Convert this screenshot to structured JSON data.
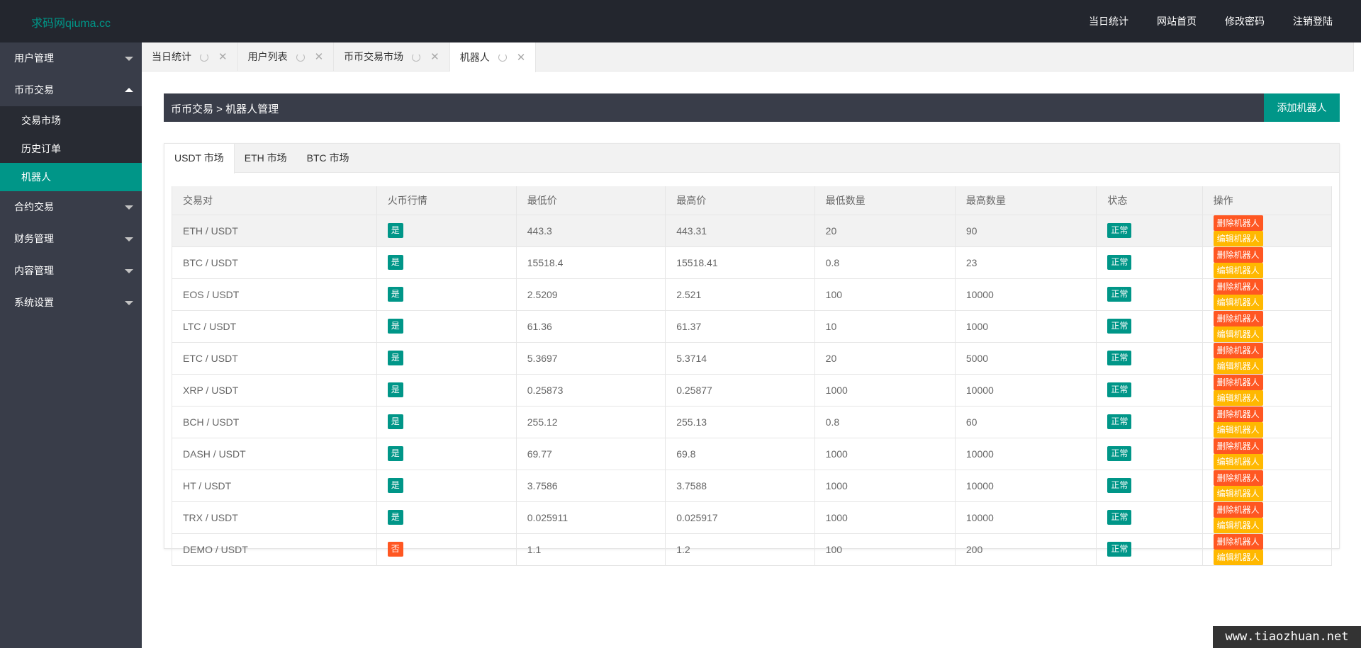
{
  "header": {
    "logo": "求码网qiuma.cc",
    "nav": [
      "当日统计",
      "网站首页",
      "修改密码",
      "注销登陆"
    ]
  },
  "sidebar": {
    "menus": [
      {
        "label": "用户管理",
        "expanded": false
      },
      {
        "label": "币币交易",
        "expanded": true,
        "items": [
          "交易市场",
          "历史订单",
          "机器人"
        ],
        "active": "机器人"
      },
      {
        "label": "合约交易",
        "expanded": false
      },
      {
        "label": "财务管理",
        "expanded": false
      },
      {
        "label": "内容管理",
        "expanded": false
      },
      {
        "label": "系统设置",
        "expanded": false
      }
    ]
  },
  "tabs": [
    "当日统计",
    "用户列表",
    "币币交易市场",
    "机器人"
  ],
  "active_tab": "机器人",
  "page": {
    "title": "币币交易 > 机器人管理",
    "add_button": "添加机器人"
  },
  "market_tabs": [
    "USDT 市场",
    "ETH 市场",
    "BTC 市场"
  ],
  "table": {
    "headers": [
      "交易对",
      "火币行情",
      "最低价",
      "最高价",
      "最低数量",
      "最高数量",
      "状态",
      "操作"
    ],
    "rows": [
      [
        "ETH / USDT",
        "是",
        "443.3",
        "443.31",
        "20",
        "90",
        "正常"
      ],
      [
        "BTC / USDT",
        "是",
        "15518.4",
        "15518.41",
        "0.8",
        "23",
        "正常"
      ],
      [
        "EOS / USDT",
        "是",
        "2.5209",
        "2.521",
        "100",
        "10000",
        "正常"
      ],
      [
        "LTC / USDT",
        "是",
        "61.36",
        "61.37",
        "10",
        "1000",
        "正常"
      ],
      [
        "ETC / USDT",
        "是",
        "5.3697",
        "5.3714",
        "20",
        "5000",
        "正常"
      ],
      [
        "XRP / USDT",
        "是",
        "0.25873",
        "0.25877",
        "1000",
        "10000",
        "正常"
      ],
      [
        "BCH / USDT",
        "是",
        "255.12",
        "255.13",
        "0.8",
        "60",
        "正常"
      ],
      [
        "DASH / USDT",
        "是",
        "69.77",
        "69.8",
        "1000",
        "10000",
        "正常"
      ],
      [
        "HT / USDT",
        "是",
        "3.7586",
        "3.7588",
        "1000",
        "10000",
        "正常"
      ],
      [
        "TRX / USDT",
        "是",
        "0.025911",
        "0.025917",
        "1000",
        "10000",
        "正常"
      ],
      [
        "DEMO / USDT",
        "否",
        "1.1",
        "1.2",
        "100",
        "200",
        "正常"
      ]
    ],
    "delete_label": "删除机器人",
    "edit_label": "编辑机器人"
  },
  "watermark": "www.tiaozhuan.net",
  "colors": {
    "header_bg": "#23262e",
    "sidebar_bg": "#393d49",
    "accent": "#009688",
    "danger": "#ff5722",
    "warn": "#ffb800"
  }
}
